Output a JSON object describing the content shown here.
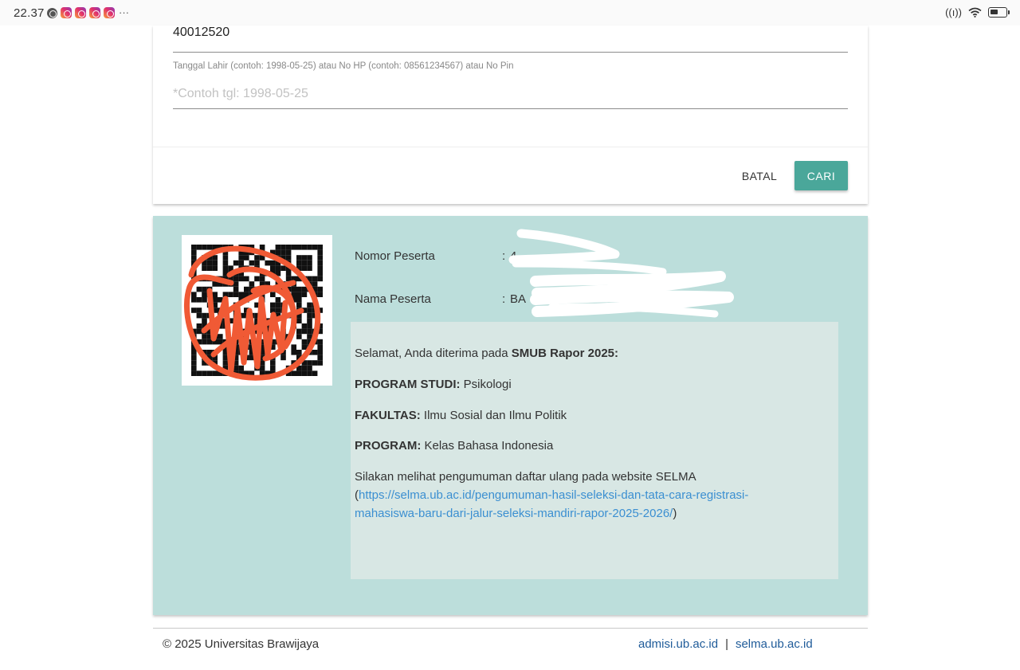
{
  "status_bar": {
    "time": "22.37",
    "left_icons": [
      "settings-icon",
      "instagram-icon",
      "instagram-icon",
      "instagram-icon",
      "instagram-icon"
    ],
    "more": "···",
    "right_icons": [
      "nfc-icon",
      "wifi-icon",
      "battery-icon"
    ]
  },
  "search_form": {
    "participant_number_value": "40012520",
    "dob_label": "Tanggal Lahir (contoh: 1998-05-25) atau No HP (contoh: 08561234567) atau No Pin",
    "dob_placeholder": "*Contoh tgl: 1998-05-25",
    "dob_value": "",
    "cancel_label": "BATAL",
    "search_label": "CARI",
    "accent_color": "#4aa79a"
  },
  "result": {
    "background_color": "#bcdedb",
    "nomor_label": "Nomor Peserta",
    "nomor_colon": ":",
    "nomor_value_visible": "4",
    "nama_label": "Nama Peserta",
    "nama_colon": ":",
    "nama_value_visible": "BA",
    "message": {
      "greeting": "Selamat, Anda diterima pada ",
      "program_name": "SMUB Rapor 2025:",
      "prodi_label": "PROGRAM STUDI:",
      "prodi_value": " Psikologi",
      "fakultas_label": "FAKULTAS:",
      "fakultas_value": " Ilmu Sosial dan Ilmu Politik",
      "program_label": "PROGRAM:",
      "program_value": " Kelas Bahasa Indonesia",
      "notice": "Silakan melihat pengumuman daftar ulang pada website SELMA",
      "paren_open": "(",
      "link_line1": "https://selma.ub.ac.id/pengumuman-hasil-seleksi-dan-tata-cara-registrasi-",
      "link_line2": "mahasiswa-baru-dari-jalur-seleksi-mandiri-rapor-2025-2026/",
      "paren_close": ")"
    }
  },
  "footer": {
    "copyright": "© 2025 Universitas Brawijaya",
    "link1": "admisi.ub.ac.id",
    "separator": "|",
    "link2": "selma.ub.ac.id"
  }
}
